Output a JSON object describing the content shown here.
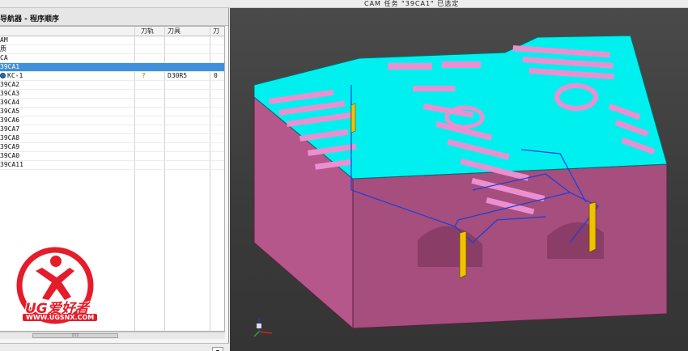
{
  "window": {
    "title": "CAM 任务 \"39CA1\" 已选定"
  },
  "navigator": {
    "title": "导航器 - 程序顺序",
    "columns": {
      "name": "",
      "toolpath": "刀轨",
      "tool": "刀具",
      "tool_number": "刀"
    },
    "rows": [
      {
        "name": "AM",
        "toolpath": "",
        "tool": "",
        "tool_number": ""
      },
      {
        "name": "质",
        "toolpath": "",
        "tool": "",
        "tool_number": ""
      },
      {
        "name": "CA",
        "toolpath": "",
        "tool": "",
        "tool_number": ""
      },
      {
        "name": "39CA1",
        "toolpath": "",
        "tool": "",
        "tool_number": "",
        "selected": true
      },
      {
        "name": "KC-1",
        "toolpath": "?",
        "tool": "D30R5",
        "tool_number": "0",
        "operation": true
      },
      {
        "name": "39CA2",
        "toolpath": "",
        "tool": "",
        "tool_number": ""
      },
      {
        "name": "39CA3",
        "toolpath": "",
        "tool": "",
        "tool_number": ""
      },
      {
        "name": "39CA4",
        "toolpath": "",
        "tool": "",
        "tool_number": ""
      },
      {
        "name": "39CA5",
        "toolpath": "",
        "tool": "",
        "tool_number": ""
      },
      {
        "name": "39CA6",
        "toolpath": "",
        "tool": "",
        "tool_number": ""
      },
      {
        "name": "39CA7",
        "toolpath": "",
        "tool": "",
        "tool_number": ""
      },
      {
        "name": "39CA8",
        "toolpath": "",
        "tool": "",
        "tool_number": ""
      },
      {
        "name": "39CA9",
        "toolpath": "",
        "tool": "",
        "tool_number": ""
      },
      {
        "name": "39CA0",
        "toolpath": "",
        "tool": "",
        "tool_number": ""
      },
      {
        "name": "39CA11",
        "toolpath": "",
        "tool": "",
        "tool_number": ""
      }
    ],
    "scroll_thumb": "III"
  },
  "watermark": {
    "brand": "UG爱好者",
    "url": "WWW.UGSNX.COM"
  },
  "footer": {
    "dropdown_icon": "chevron-down-icon"
  },
  "colors": {
    "selection": "#3f8fdc",
    "part_top": "#00f0f0",
    "part_side": "#b5578a",
    "pocket_floor": "#ec8fd0",
    "toolpath": "#1a3fd8",
    "watermark_red": "#e51c2a"
  }
}
